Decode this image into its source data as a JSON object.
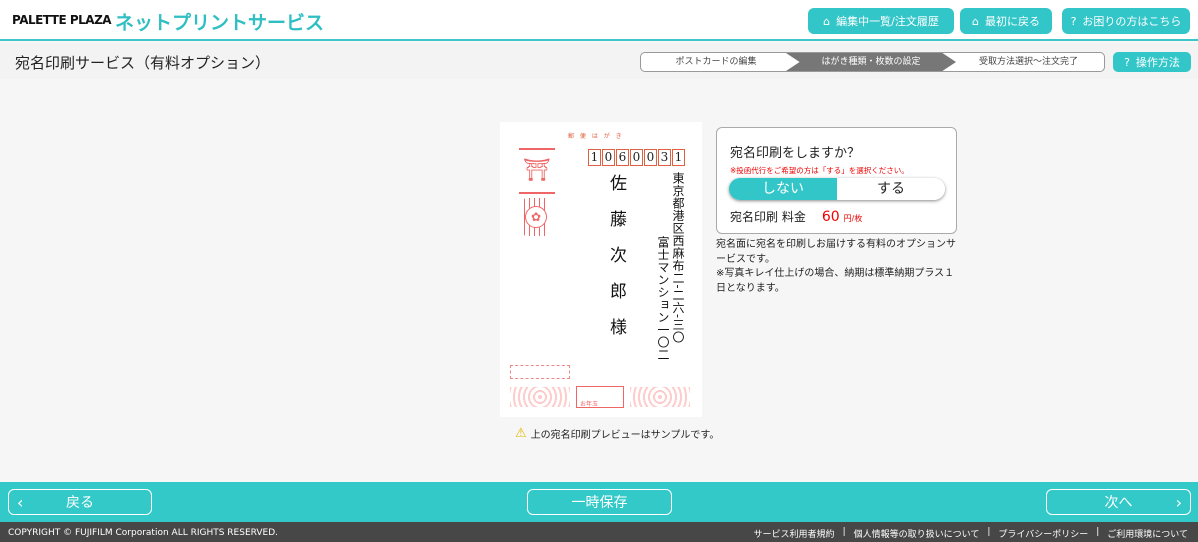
{
  "header": {
    "logo": "PALETTE PLAZA",
    "service": "ネットプリントサービス",
    "buttons": [
      {
        "label": "編集中一覧/注文履歴",
        "icon": "home-icon"
      },
      {
        "label": "最初に戻る",
        "icon": "home-icon"
      },
      {
        "label": "お困りの方はこちら",
        "icon": "question-icon"
      }
    ]
  },
  "page": {
    "title": "宛名印刷サービス（有料オプション）",
    "steps": [
      "ポストカードの編集",
      "はがき種類・枚数の設定",
      "受取方法選択～注文完了"
    ],
    "active_step": 1,
    "help": "操作方法",
    "help_icon": "?"
  },
  "card": {
    "heading": "郵 便 は が き",
    "zip": [
      "1",
      "0",
      "6",
      "0",
      "0",
      "3",
      "1"
    ],
    "name": "佐藤次郎様",
    "address1": "東京都港区西麻布二‐二六‐三〇",
    "address2": "富士マンション一〇二",
    "stamp": "お年玉"
  },
  "option": {
    "question": "宛名印刷をしますか？",
    "note": "※投函代行をご希望の方は「する」を選択ください。",
    "choices": [
      "しない",
      "する"
    ],
    "selected": "しない",
    "price_label": "宛名印刷 料金",
    "price": "60",
    "price_unit": "円/枚"
  },
  "description": [
    "宛名面に宛名を印刷しお届けする有料のオプションサービスです。",
    "※写真キレイ仕上げの場合、納期は標準納期プラス１日となります。"
  ],
  "warning": "上の宛名印刷プレビューはサンプルです。",
  "footer": {
    "back": "戻る",
    "save": "一時保存",
    "next": "次へ",
    "copyright": "COPYRIGHT © FUJIFILM Corporation ALL RIGHTS RESERVED.",
    "links": [
      "サービス利用者規約",
      "個人情報等の取り扱いについて",
      "プライバシーポリシー",
      "ご利用環境について"
    ]
  },
  "colors": {
    "accent": "#33c6c9",
    "price": "#e00000",
    "footer_dark": "#474747"
  }
}
